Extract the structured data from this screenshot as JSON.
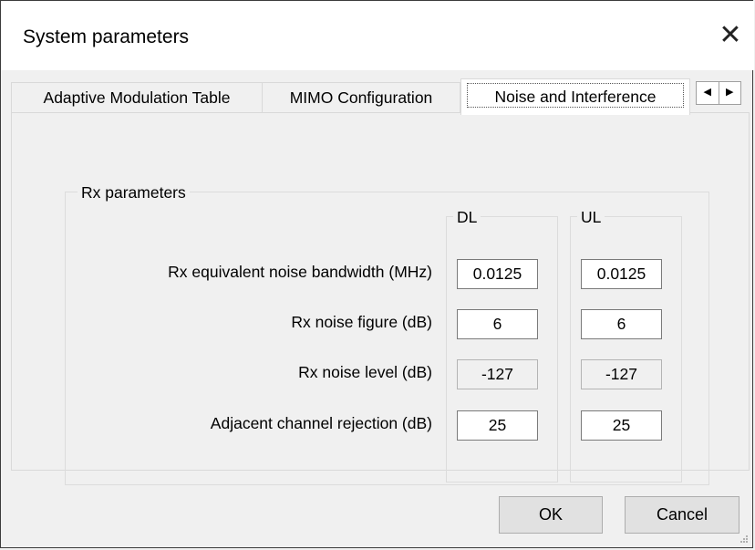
{
  "window": {
    "title": "System parameters"
  },
  "tabs": [
    {
      "label": "Adaptive Modulation Table"
    },
    {
      "label": "MIMO Configuration"
    },
    {
      "label": "Noise and Interference",
      "active": true
    }
  ],
  "rx_group": {
    "title": "Rx parameters",
    "dl_label": "DL",
    "ul_label": "UL",
    "rows": [
      {
        "label": "Rx equivalent noise bandwidth (MHz)",
        "dl": "0.0125",
        "ul": "0.0125"
      },
      {
        "label": "Rx noise figure (dB)",
        "dl": "6",
        "ul": "6"
      },
      {
        "label": "Rx noise level (dB)",
        "dl": "-127",
        "ul": "-127",
        "readonly": true
      },
      {
        "label": "Adjacent channel rejection (dB)",
        "dl": "25",
        "ul": "25"
      }
    ]
  },
  "buttons": {
    "ok": "OK",
    "cancel": "Cancel"
  },
  "icons": {
    "close": "close-icon",
    "scroll_left": "arrow-left-icon",
    "scroll_right": "arrow-right-icon"
  }
}
